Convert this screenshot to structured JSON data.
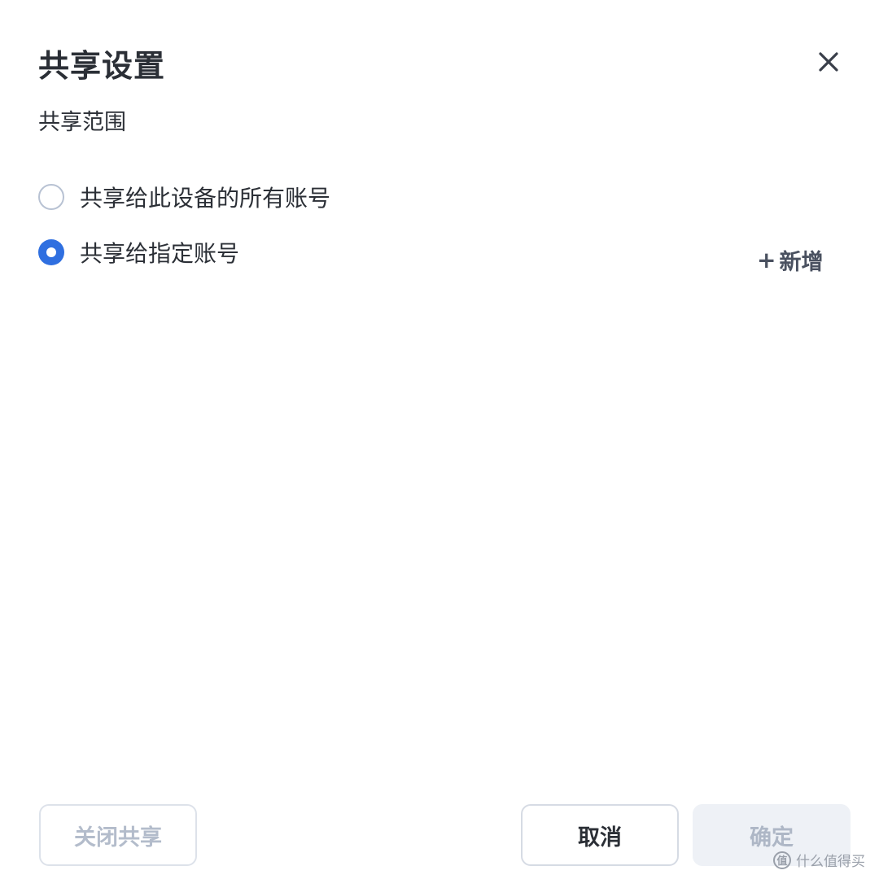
{
  "dialog": {
    "title": "共享设置",
    "close_icon": "close-icon"
  },
  "scope": {
    "label": "共享范围",
    "options": [
      {
        "label": "共享给此设备的所有账号",
        "checked": false
      },
      {
        "label": "共享给指定账号",
        "checked": true
      }
    ],
    "add_button": {
      "icon": "plus-icon",
      "label": "新增"
    }
  },
  "footer": {
    "close_share_label": "关闭共享",
    "cancel_label": "取消",
    "confirm_label": "确定"
  },
  "watermark": {
    "icon": "值",
    "text": "什么值得买"
  },
  "colors": {
    "accent": "#2f6fe0",
    "text": "#2b2f36",
    "disabled_text": "#b3bccb",
    "disabled_bg": "#eef1f6"
  }
}
